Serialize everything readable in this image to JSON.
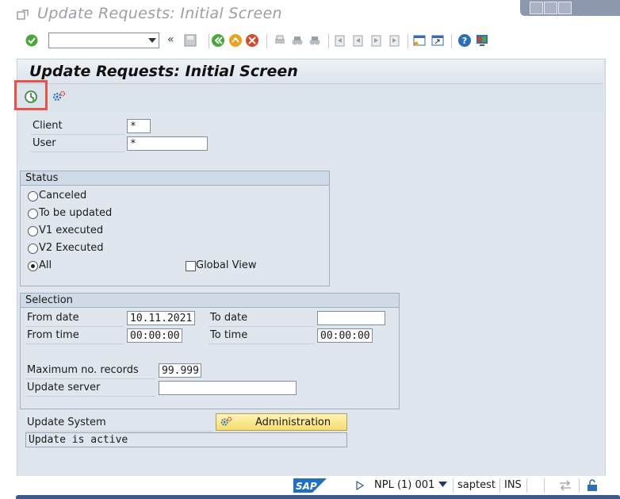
{
  "window": {
    "title": "Update Requests: Initial Screen",
    "controls": [
      "minimize",
      "maximize",
      "close"
    ]
  },
  "system_toolbar": {
    "command_field": "",
    "chevron": "«"
  },
  "screen": {
    "title": "Update Requests: Initial Screen"
  },
  "form": {
    "client_label": "Client",
    "client_value": "*",
    "user_label": "User",
    "user_value": "*"
  },
  "status_group": {
    "title": "Status",
    "options": [
      "Canceled",
      "To be updated",
      "V1 executed",
      "V2 Executed",
      "All"
    ],
    "selected": "All",
    "global_view_label": "Global View",
    "global_view_checked": false
  },
  "selection_group": {
    "title": "Selection",
    "from_date_label": "From date",
    "from_date_value": "10.11.2021",
    "to_date_label": "To date",
    "to_date_value": "",
    "from_time_label": "From time",
    "from_time_value": "00:00:00",
    "to_time_label": "To time",
    "to_time_value": "00:00:00",
    "max_records_label": "Maximum no. records",
    "max_records_value": "99.999",
    "update_server_label": "Update server",
    "update_server_value": ""
  },
  "update_system": {
    "label": "Update System",
    "admin_button": "Administration",
    "status_text": "Update is active"
  },
  "statusbar": {
    "logo": "SAP",
    "system": "NPL (1) 001",
    "user": "saptest",
    "mode": "INS"
  },
  "colors": {
    "highlight": "#e4544a",
    "button_yellow": "#f6dd6c",
    "frame_bg": "#dfe6ee"
  }
}
